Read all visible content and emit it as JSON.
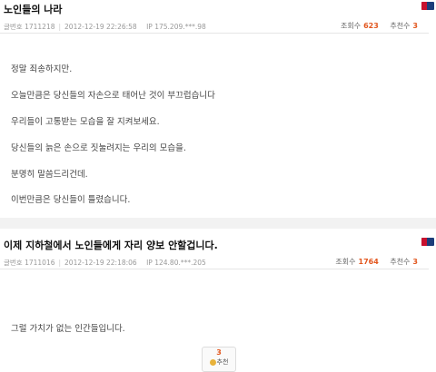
{
  "posts": [
    {
      "title": "노인들의 나라",
      "meta": {
        "num_label": "글번호",
        "num": "1711218",
        "date": "2012-12-19 22:26:58",
        "ip_label": "IP",
        "ip": "175.209.***.98",
        "views_label": "조회수",
        "views": "623",
        "recs_label": "추천수",
        "recs": "3"
      },
      "lines": [
        "정말 죄송하지만.",
        "오늘만큼은 당신들의 자손으로 태어난 것이 부끄럽습니다",
        "우리들이 고통받는 모습을 잘 지켜보세요.",
        "당신들의 늙은 손으로 짓눌려지는 우리의 모습을.",
        "분명히 말씀드리건데.",
        "이번만큼은 당신들이 틀렸습니다."
      ]
    },
    {
      "title": "이제 지하철에서 노인들에게 자리 양보 안할겁니다.",
      "meta": {
        "num_label": "글번호",
        "num": "1711016",
        "date": "2012-12-19 22:18:06",
        "ip_label": "IP",
        "ip": "124.80.***.205",
        "views_label": "조회수",
        "views": "1764",
        "recs_label": "추천수",
        "recs": "3"
      },
      "lines": [
        "그럴 가치가 없는 인간들입니다."
      ],
      "rec_button": {
        "count": "3",
        "label": "추천"
      }
    }
  ],
  "icons": {
    "logo": "mlb-logo-icon",
    "recommend": "thumb-up-icon"
  },
  "colors": {
    "accent": "#e2571f",
    "logo_blue": "#1d3d7a",
    "logo_red": "#c8102e"
  }
}
